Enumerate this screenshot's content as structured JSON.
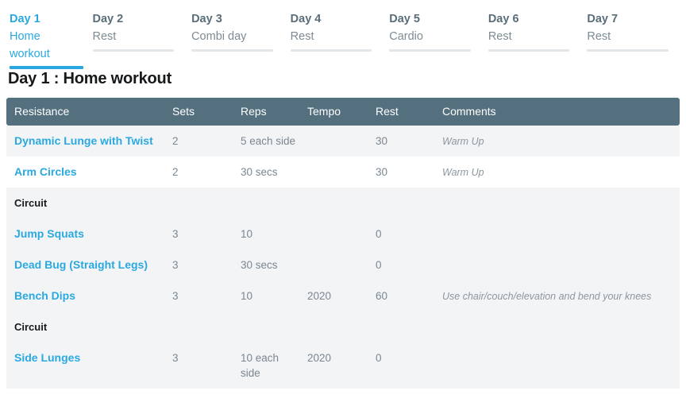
{
  "tabs": [
    {
      "day": "Day 1",
      "desc": "Home workout",
      "active": true
    },
    {
      "day": "Day 2",
      "desc": "Rest",
      "active": false
    },
    {
      "day": "Day 3",
      "desc": "Combi day",
      "active": false
    },
    {
      "day": "Day 4",
      "desc": "Rest",
      "active": false
    },
    {
      "day": "Day 5",
      "desc": "Cardio",
      "active": false
    },
    {
      "day": "Day 6",
      "desc": "Rest",
      "active": false
    },
    {
      "day": "Day 7",
      "desc": "Rest",
      "active": false
    }
  ],
  "page": {
    "title": "Day 1 : Home workout"
  },
  "table": {
    "columns": [
      "Resistance",
      "Sets",
      "Reps",
      "Tempo",
      "Rest",
      "Comments"
    ],
    "rows": [
      {
        "type": "exercise",
        "shade": true,
        "resistance": "Dynamic Lunge with Twist",
        "sets": "2",
        "reps": "5 each side",
        "tempo": "",
        "rest": "30",
        "comments": "Warm Up"
      },
      {
        "type": "exercise",
        "shade": false,
        "resistance": "Arm Circles",
        "sets": "2",
        "reps": "30 secs",
        "tempo": "",
        "rest": "30",
        "comments": "Warm Up"
      },
      {
        "type": "group",
        "shade": true,
        "label": "Circuit"
      },
      {
        "type": "exercise",
        "shade": true,
        "resistance": "Jump Squats",
        "sets": "3",
        "reps": "10",
        "tempo": "",
        "rest": "0",
        "comments": ""
      },
      {
        "type": "exercise",
        "shade": true,
        "resistance": "Dead Bug (Straight Legs)",
        "sets": "3",
        "reps": "30 secs",
        "tempo": "",
        "rest": "0",
        "comments": ""
      },
      {
        "type": "exercise",
        "shade": true,
        "resistance": "Bench Dips",
        "sets": "3",
        "reps": "10",
        "tempo": "2020",
        "rest": "60",
        "comments": "Use chair/couch/elevation and bend your knees"
      },
      {
        "type": "group",
        "shade": true,
        "label": "Circuit"
      },
      {
        "type": "exercise",
        "shade": true,
        "resistance": "Side Lunges",
        "sets": "3",
        "reps": "10 each side",
        "tempo": "2020",
        "rest": "0",
        "comments": ""
      }
    ]
  },
  "colors": {
    "accent": "#2aa9e0",
    "header_bar": "#54707f",
    "row_shade": "#f3f4f6",
    "text_muted": "#7a8791",
    "title": "#16181a"
  }
}
